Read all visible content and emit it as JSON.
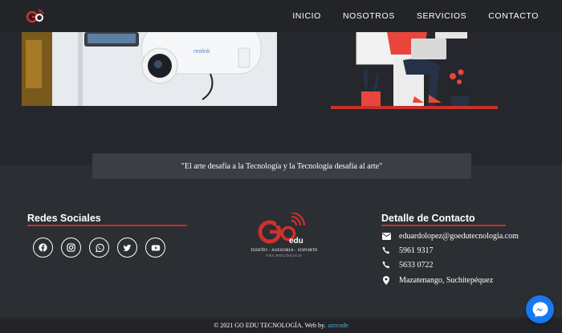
{
  "nav": {
    "items": [
      {
        "label": "INICIO"
      },
      {
        "label": "NOSOTROS"
      },
      {
        "label": "SERVICIOS"
      },
      {
        "label": "CONTACTO"
      }
    ]
  },
  "quote": "\"El arte desafía a la Tecnología y la Tecnología desafía al arte\"",
  "social": {
    "title": "Redes Sociales",
    "icons": [
      "facebook-icon",
      "instagram-icon",
      "whatsapp-icon",
      "twitter-icon",
      "youtube-icon"
    ]
  },
  "footer_logo": {
    "brand": "edu",
    "tagline": "DISEÑO - ASESORIA - SOPORTE",
    "sub": "TECNOLÓGICO"
  },
  "contact": {
    "title": "Detalle de Contacto",
    "email": "eduardolopez@goedutecnologia.com",
    "phone1": "5961 9317",
    "phone2": "5633 0722",
    "address": "Mazatenango, Suchitepéquez"
  },
  "footer": {
    "copyright": "© 2021 GO EDU TECNOLOGÍA. Web by.",
    "credit": "axrcode"
  },
  "colors": {
    "accent": "#c8312a",
    "background": "#2b2e33",
    "navbar": "#222428",
    "messenger": "#1877f2",
    "link": "#4fb3d9"
  }
}
